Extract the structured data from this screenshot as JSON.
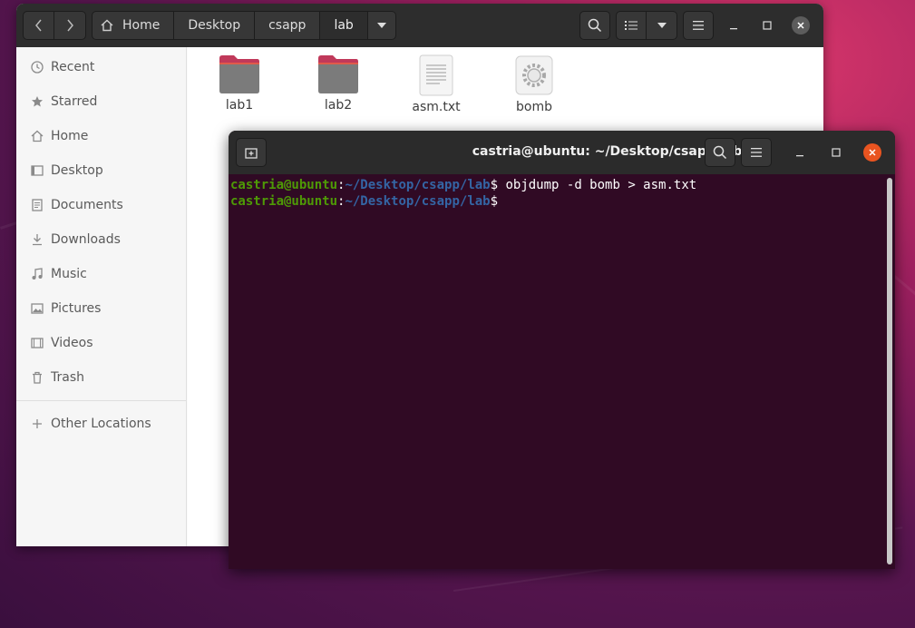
{
  "files_window": {
    "breadcrumbs": [
      "Home",
      "Desktop",
      "csapp",
      "lab"
    ],
    "sidebar": {
      "items": [
        {
          "label": "Recent",
          "icon": "clock-icon"
        },
        {
          "label": "Starred",
          "icon": "star-icon"
        },
        {
          "label": "Home",
          "icon": "home-icon"
        },
        {
          "label": "Desktop",
          "icon": "desktop-icon"
        },
        {
          "label": "Documents",
          "icon": "document-icon"
        },
        {
          "label": "Downloads",
          "icon": "download-icon"
        },
        {
          "label": "Music",
          "icon": "music-icon"
        },
        {
          "label": "Pictures",
          "icon": "picture-icon"
        },
        {
          "label": "Videos",
          "icon": "video-icon"
        },
        {
          "label": "Trash",
          "icon": "trash-icon"
        }
      ],
      "other_locations": "Other Locations"
    },
    "files": [
      {
        "name": "lab1",
        "type": "folder"
      },
      {
        "name": "lab2",
        "type": "folder"
      },
      {
        "name": "asm.txt",
        "type": "text"
      },
      {
        "name": "bomb",
        "type": "executable"
      }
    ]
  },
  "terminal": {
    "title": "castria@ubuntu: ~/Desktop/csapp/lab",
    "lines": [
      {
        "user": "castria@ubuntu",
        "sep": ":",
        "path": "~/Desktop/csapp/lab",
        "prompt": "$ ",
        "command": "objdump -d bomb > asm.txt"
      },
      {
        "user": "castria@ubuntu",
        "sep": ":",
        "path": "~/Desktop/csapp/lab",
        "prompt": "$",
        "command": ""
      }
    ]
  },
  "colors": {
    "terminal_bg": "#300a24",
    "prompt_user": "#4e9a06",
    "prompt_path": "#3465a4",
    "close_accent": "#e95420",
    "folder_top": "#c0395a"
  }
}
